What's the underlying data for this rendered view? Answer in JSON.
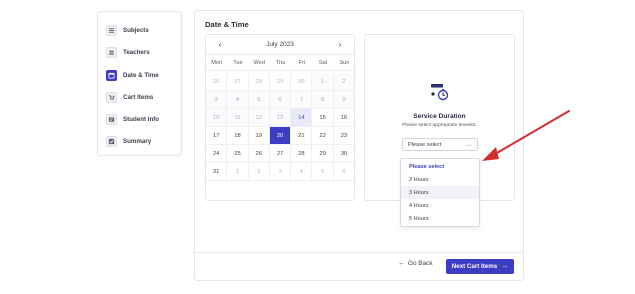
{
  "sidebar": {
    "items": [
      {
        "label": "Subjects",
        "icon": "list-icon",
        "active": false
      },
      {
        "label": "Teachers",
        "icon": "people-icon",
        "active": false
      },
      {
        "label": "Date & Time",
        "icon": "calendar-icon",
        "active": true
      },
      {
        "label": "Cart Items",
        "icon": "cart-icon",
        "active": false
      },
      {
        "label": "Student Info",
        "icon": "id-card-icon",
        "active": false
      },
      {
        "label": "Summary",
        "icon": "check-icon",
        "active": false
      }
    ]
  },
  "main": {
    "title": "Date & Time"
  },
  "calendar": {
    "month": "July 2023",
    "prev": "‹",
    "next": "›",
    "weekdays": [
      "Mon",
      "Tue",
      "Wed",
      "Thu",
      "Fri",
      "Sat",
      "Sun"
    ],
    "weeks": [
      [
        "26",
        "27",
        "28",
        "29",
        "30",
        "1",
        "2"
      ],
      [
        "3",
        "4",
        "5",
        "6",
        "7",
        "8",
        "9"
      ],
      [
        "10",
        "11",
        "12",
        "13",
        "14",
        "15",
        "16"
      ],
      [
        "17",
        "18",
        "19",
        "20",
        "21",
        "22",
        "23"
      ],
      [
        "24",
        "25",
        "26",
        "27",
        "28",
        "29",
        "30"
      ],
      [
        "31",
        "1",
        "2",
        "3",
        "4",
        "5",
        "6"
      ]
    ],
    "today": "14",
    "selected": "20"
  },
  "duration": {
    "title": "Service Duration",
    "subtitle": "Please select appropriate timeslot.",
    "select_value": "Please select",
    "options": [
      "Please select",
      "2 Hours",
      "3 Hours",
      "4 Hours",
      "5 Hours"
    ],
    "hovered_option": "3 Hours"
  },
  "footer": {
    "back_label": "Go Back",
    "next_label": "Next Cart Items"
  },
  "colors": {
    "accent": "#3d3dc4",
    "today_bg": "#e9e8fb",
    "annotation_arrow": "#d32f2f"
  }
}
